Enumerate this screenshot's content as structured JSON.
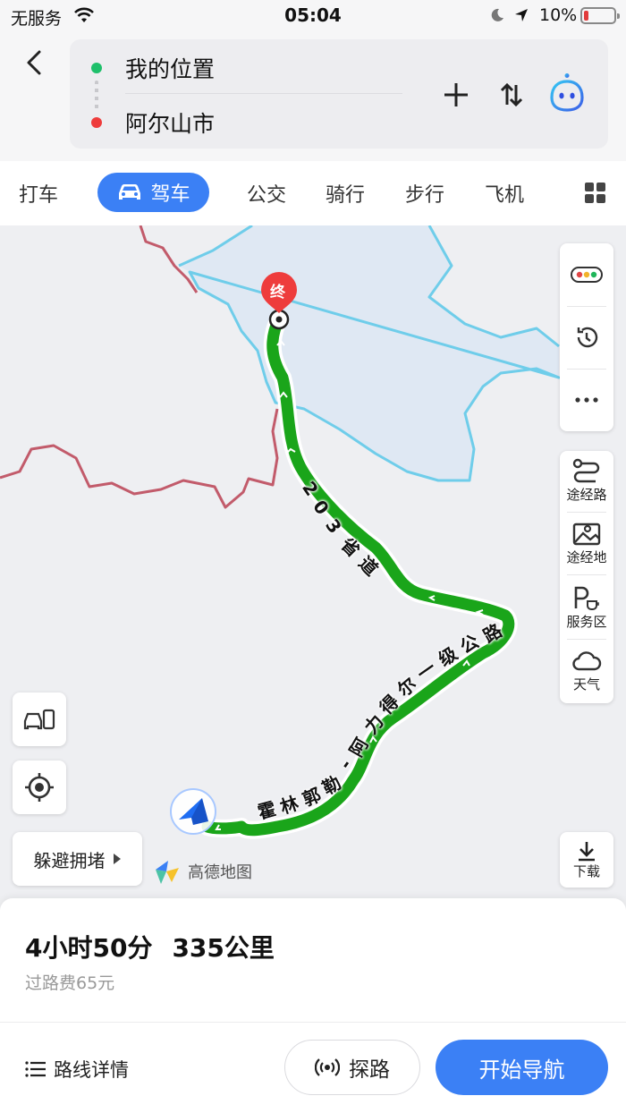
{
  "status_bar": {
    "carrier": "无服务",
    "time": "05:04",
    "battery": "10%"
  },
  "route": {
    "from": "我的位置",
    "to": "阿尔山市"
  },
  "modes": {
    "taxi": "打车",
    "drive": "驾车",
    "bus": "公交",
    "bike": "骑行",
    "walk": "步行",
    "plane": "飞机"
  },
  "map": {
    "end_marker": "终",
    "road_203": [
      "2",
      "0",
      "3",
      "省",
      "道"
    ],
    "road_aershan": [
      "阿",
      "力",
      "得",
      "尔",
      "一",
      "级",
      "公",
      "路"
    ],
    "road_huolin": [
      "霍",
      "林",
      "郭",
      "勒",
      "-"
    ],
    "side_tools": [
      {
        "label": "途经路",
        "icon": "waypoint-road-icon"
      },
      {
        "label": "途经地",
        "icon": "waypoint-place-icon"
      },
      {
        "label": "服务区",
        "icon": "service-area-icon"
      },
      {
        "label": "天气",
        "icon": "weather-icon"
      }
    ],
    "avoid_label": "躲避拥堵",
    "brand": "高德地图",
    "download_label": "下载"
  },
  "summary": {
    "duration": "4小时50分",
    "distance": "335公里",
    "toll": "过路费65元"
  },
  "actions": {
    "details": "路线详情",
    "explore": "探路",
    "start": "开始导航"
  },
  "colors": {
    "accent": "#3b80f5",
    "route": "#1aa51a",
    "start_dot": "#1fc06b",
    "end_dot": "#ee3c3c",
    "boundary_blue": "#6fcdea",
    "boundary_red": "#c25b6b"
  }
}
